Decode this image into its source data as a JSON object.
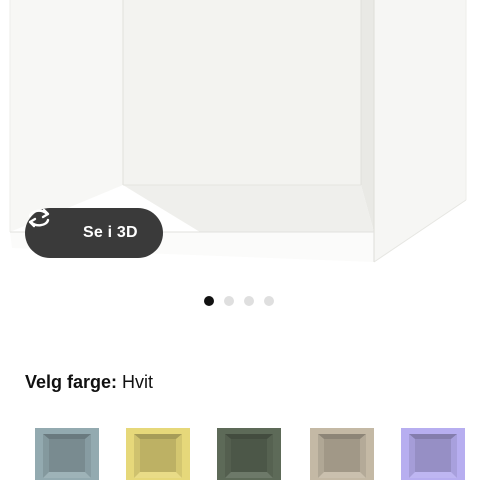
{
  "product_image": {
    "view_3d_label": "Se i 3D",
    "carousel_dots": [
      {
        "active": true
      },
      {
        "active": false
      },
      {
        "active": false
      },
      {
        "active": false
      }
    ]
  },
  "color_picker": {
    "label": "Velg farge:",
    "selected_value": "Hvit",
    "swatches": [
      {
        "name": "grey-turquoise",
        "color": "#93aab0"
      },
      {
        "name": "yellow",
        "color": "#e6d87a"
      },
      {
        "name": "dark-green",
        "color": "#5d6a58"
      },
      {
        "name": "beige",
        "color": "#c4b9a5"
      },
      {
        "name": "lilac",
        "color": "#b7aef0"
      }
    ]
  },
  "colors": {
    "button_bg": "#3a3a3a",
    "dot_active": "#111111",
    "dot_inactive": "#dfdfdf"
  }
}
